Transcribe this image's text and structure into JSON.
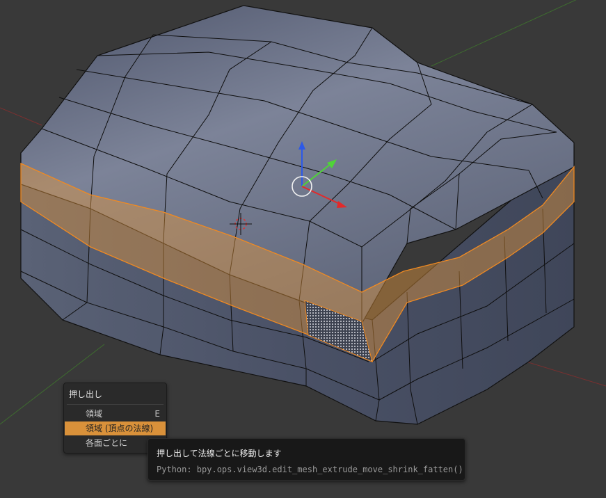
{
  "colors": {
    "background": "#393939",
    "mesh": "#6a7286",
    "selection": "#e0953c",
    "menu_highlight": "#d9913a",
    "axis_x": "#e32a2a",
    "axis_y": "#4fd437",
    "axis_z": "#2c59e8"
  },
  "menu": {
    "title": "押し出し",
    "items": [
      {
        "label": "領域",
        "shortcut": "E"
      },
      {
        "label": "領域 (頂点の法線)",
        "shortcut": ""
      },
      {
        "label": "各面ごとに",
        "shortcut": ""
      }
    ],
    "active_index": 1
  },
  "tooltip": {
    "title": "押し出して法線ごとに移動します",
    "python": "Python: bpy.ops.view3d.edit_mesh_extrude_move_shrink_fatten()"
  },
  "icons": {
    "gizmo": "transform-gizmo-icon",
    "cursor": "3d-cursor-icon"
  }
}
